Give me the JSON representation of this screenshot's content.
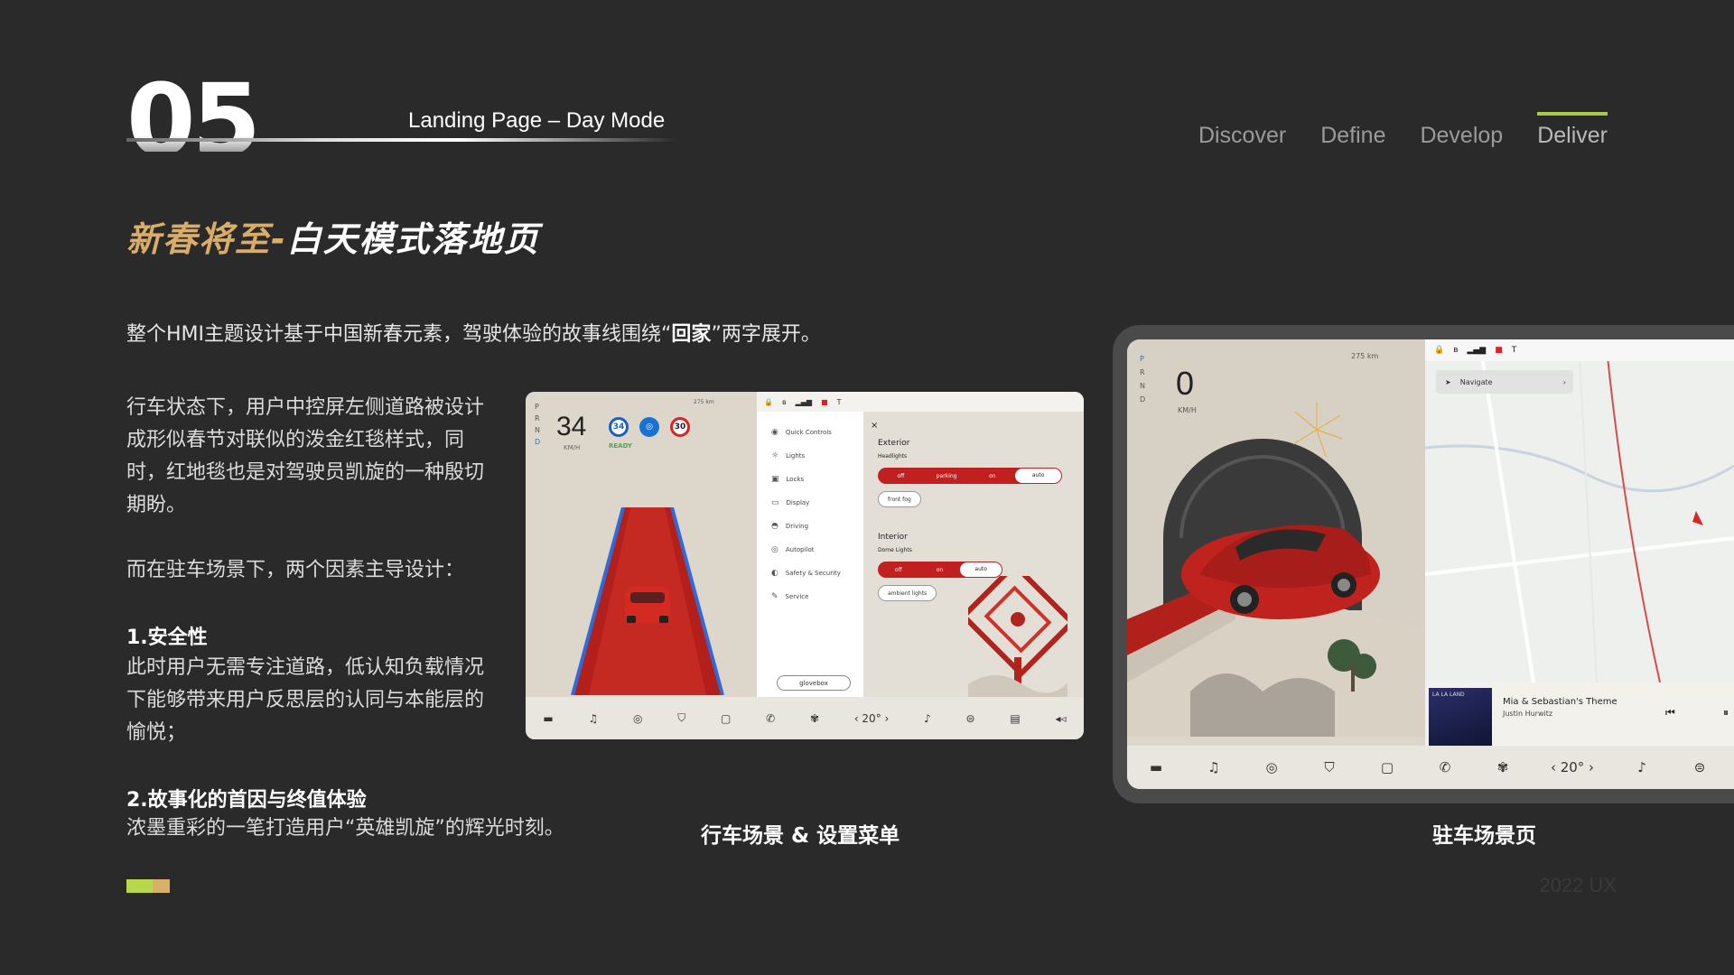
{
  "header": {
    "section_number": "05",
    "subtitle": "Landing Page – Day Mode",
    "nav": [
      "Discover",
      "Define",
      "Develop",
      "Deliver"
    ],
    "active_nav": "Deliver"
  },
  "title": {
    "part1": "新春将至-",
    "part2": "白天模式落地页"
  },
  "intro": {
    "before": "整个HMI主题设计基于中国新春元素，驾驶体验的故事线围绕“",
    "highlight": "回家",
    "after": "”两字展开。"
  },
  "body": {
    "p1": "行车状态下，用户中控屏左侧道路被设计成形似春节对联似的泼金红毯样式，同时，红地毯也是对驾驶员凯旋的一种殷切期盼。",
    "p2": "而在驻车场景下，两个因素主导设计：",
    "h1": "1.安全性",
    "p3": "此时用户无需专注道路，低认知负载情况下能够带来用户反思层的认同与本能层的愉悦；",
    "h2": "2.故事化的首因与终值体验",
    "p4": "浓墨重彩的一笔打造用户“英雄凯旋”的辉光时刻。"
  },
  "captions": {
    "screen1": "行车场景 & 设置菜单",
    "screen2": "驻车场景页"
  },
  "footer": {
    "year": "2022 UX"
  },
  "screen1": {
    "gears": [
      "P",
      "R",
      "N",
      "D"
    ],
    "speed": "34",
    "speed_unit": "KM/H",
    "ready": "READY",
    "signs": [
      "34",
      "",
      "30"
    ],
    "range": "275 km",
    "menu": [
      {
        "icon": "car-icon",
        "glyph": "◉",
        "label": "Quick Controls"
      },
      {
        "icon": "bulb-icon",
        "glyph": "☼",
        "label": "Lights"
      },
      {
        "icon": "lock-icon",
        "glyph": "▣",
        "label": "Locks"
      },
      {
        "icon": "display-icon",
        "glyph": "▭",
        "label": "Display"
      },
      {
        "icon": "driving-icon",
        "glyph": "◓",
        "label": "Driving"
      },
      {
        "icon": "wheel-icon",
        "glyph": "◎",
        "label": "Autopilot"
      },
      {
        "icon": "shield-icon",
        "glyph": "◐",
        "label": "Safety & Security"
      },
      {
        "icon": "wrench-icon",
        "glyph": "✎",
        "label": "Service"
      }
    ],
    "glovebox": "glovebox",
    "exterior": "Exterior",
    "headlights": "Headlights",
    "headlight_options": [
      "off",
      "parking",
      "on",
      "auto"
    ],
    "front_fog": "front fog",
    "interior": "Interior",
    "dome_lights": "Dome Lights",
    "dome_options": [
      "off",
      "on",
      "auto"
    ],
    "ambient": "ambient lights",
    "temp": "‹ 20° ›",
    "close": "×"
  },
  "screen2": {
    "gears": [
      "P",
      "R",
      "N",
      "D"
    ],
    "speed": "0",
    "speed_unit": "KM/H",
    "range": "275 km",
    "navigate": "Navigate",
    "song": "Mia & Sebastian's Theme",
    "artist": "Justin Hurwitz",
    "album": "LA LA LAND",
    "temp": "‹ 20° ›"
  }
}
